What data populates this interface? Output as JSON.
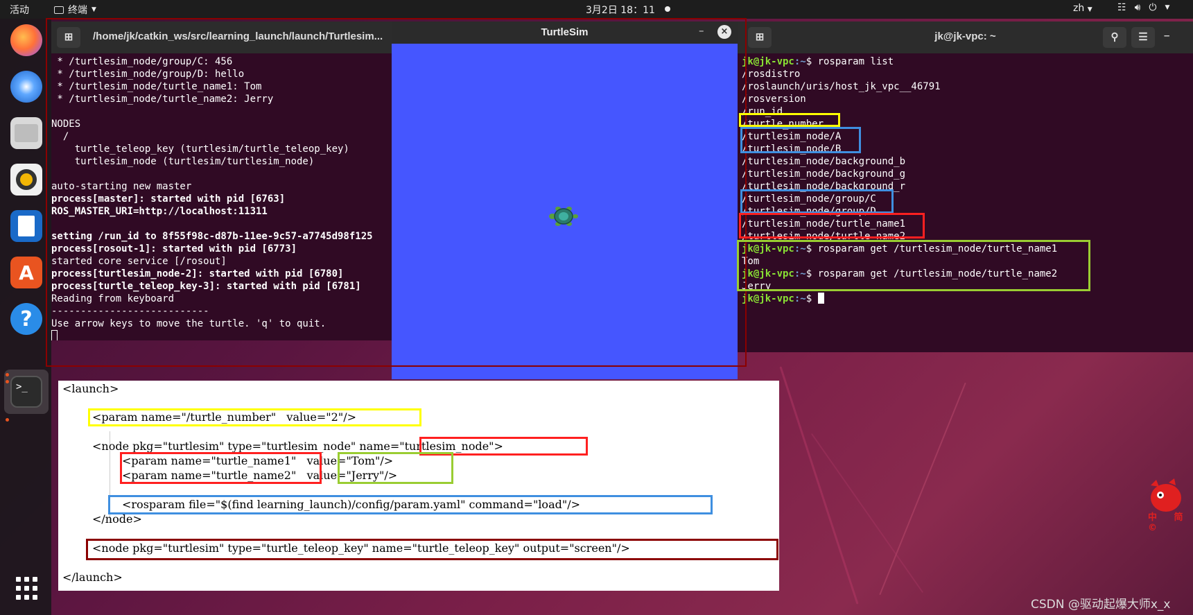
{
  "topbar": {
    "activities": "活动",
    "app_name": "终端",
    "clock": "3月2日  18：11",
    "lang": "zh"
  },
  "left_terminal": {
    "title": "/home/jk/catkin_ws/src/learning_launch/launch/Turtlesim...",
    "lines": [
      {
        "text": " * /turtlesim_node/group/C: 456",
        "bold": false
      },
      {
        "text": " * /turtlesim_node/group/D: hello",
        "bold": false
      },
      {
        "text": " * /turtlesim_node/turtle_name1: Tom",
        "bold": false
      },
      {
        "text": " * /turtlesim_node/turtle_name2: Jerry",
        "bold": false
      },
      {
        "text": "",
        "bold": false
      },
      {
        "text": "NODES",
        "bold": false
      },
      {
        "text": "  /",
        "bold": false
      },
      {
        "text": "    turtle_teleop_key (turtlesim/turtle_teleop_key)",
        "bold": false
      },
      {
        "text": "    turtlesim_node (turtlesim/turtlesim_node)",
        "bold": false
      },
      {
        "text": "",
        "bold": false
      },
      {
        "text": "auto-starting new master",
        "bold": false
      },
      {
        "text": "process[master]: started with pid [6763]",
        "bold": true
      },
      {
        "text": "ROS_MASTER_URI=http://localhost:11311",
        "bold": true
      },
      {
        "text": "",
        "bold": false
      },
      {
        "text": "setting /run_id to 8f55f98c-d87b-11ee-9c57-a7745d98f125",
        "bold": true
      },
      {
        "text": "process[rosout-1]: started with pid [6773]",
        "bold": true
      },
      {
        "text": "started core service [/rosout]",
        "bold": false
      },
      {
        "text": "process[turtlesim_node-2]: started with pid [6780]",
        "bold": true
      },
      {
        "text": "process[turtle_teleop_key-3]: started with pid [6781]",
        "bold": true
      },
      {
        "text": "Reading from keyboard",
        "bold": false
      },
      {
        "text": "---------------------------",
        "bold": false
      },
      {
        "text": "Use arrow keys to move the turtle. 'q' to quit.",
        "bold": false
      }
    ]
  },
  "turtlesim": {
    "title": "TurtleSim",
    "minimize": "–",
    "close": "×"
  },
  "right_terminal": {
    "title": "jk@jk-vpc: ~",
    "prompt_user": "jk@jk-vpc",
    "prompt_path": ":~",
    "prompt_symbol": "$ ",
    "commands": [
      {
        "cmd": "rosparam list",
        "output": [
          "/rosdistro",
          "/roslaunch/uris/host_jk_vpc__46791",
          "/rosversion",
          "/run_id",
          "/turtle_number",
          "/turtlesim_node/A",
          "/turtlesim_node/B",
          "/turtlesim_node/background_b",
          "/turtlesim_node/background_g",
          "/turtlesim_node/background_r",
          "/turtlesim_node/group/C",
          "/turtlesim_node/group/D",
          "/turtlesim_node/turtle_name1",
          "/turtlesim_node/turtle_name2"
        ]
      },
      {
        "cmd": "rosparam get /turtlesim_node/turtle_name1",
        "output": [
          "Tom"
        ]
      },
      {
        "cmd": "rosparam get /turtlesim_node/turtle_name2",
        "output": [
          "Jerry"
        ]
      }
    ]
  },
  "launch_code": {
    "lines": [
      "<launch>",
      "<param name=\"/turtle_number\"   value=\"2\"/>",
      "<node pkg=\"turtlesim\" type=\"turtlesim_node\" name=\"turtlesim_node\">",
      "<param name=\"turtle_name1\"   value=\"Tom\"/>",
      "<param name=\"turtle_name2\"   value=\"Jerry\"/>",
      "<rosparam file=\"$(find learning_launch)/config/param.yaml\" command=\"load\"/>",
      "</node>",
      "<node pkg=\"turtlesim\" type=\"turtle_teleop_key\" name=\"turtle_teleop_key\" output=\"screen\"/>",
      "</launch>"
    ]
  },
  "colors": {
    "terminal_bg": "#300a24",
    "turtlesim_bg": "#4556ff",
    "box_yellow": "#ffff00",
    "box_blue": "#3f8fe0",
    "box_red": "#ff2020",
    "box_green": "#9acd32",
    "box_darkred": "#8b0000"
  },
  "watermark": "CSDN @驱动起爆大师x_x",
  "mascot_text": "中 简 ©"
}
